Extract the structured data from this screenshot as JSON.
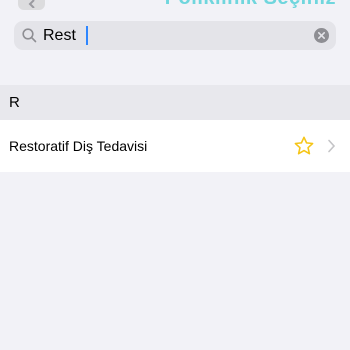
{
  "header": {
    "title": "Poliklinik Seçiniz",
    "back_icon": "chevron-left-icon",
    "title_color": "#6fd6dd"
  },
  "search": {
    "value": "Rest",
    "placeholder": "",
    "search_icon": "search-icon",
    "clear_icon": "clear-icon"
  },
  "section": {
    "header": "R"
  },
  "list": {
    "items": [
      {
        "label": "Restoratif Diş Tedavisi",
        "favorite_icon": "star-outline-icon",
        "disclosure_icon": "chevron-right-icon",
        "favorite_color": "#f5c518"
      }
    ]
  }
}
